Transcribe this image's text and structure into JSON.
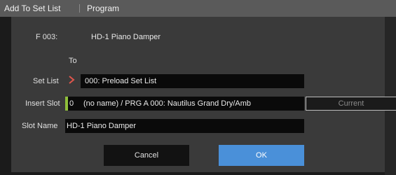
{
  "window": {
    "dialog_title": "Add To Set List",
    "mode_title": "Program"
  },
  "source": {
    "label": "F 003:",
    "program_name": "HD-1 Piano Damper"
  },
  "to_label": "To",
  "set_list": {
    "label": "Set List",
    "value": "000: Preload Set List"
  },
  "insert_slot": {
    "label": "Insert Slot",
    "number": "0",
    "value": "(no name) / PRG A 000: Nautilus Grand Dry/Amb",
    "current_button": "Current"
  },
  "slot_name": {
    "label": "Slot Name",
    "value": "HD-1 Piano Damper"
  },
  "buttons": {
    "cancel": "Cancel",
    "ok": "OK"
  },
  "colors": {
    "accent_blue": "#4a90d9",
    "slot_marker_green": "#8fbf3a",
    "chevron_red": "#e0564c"
  }
}
